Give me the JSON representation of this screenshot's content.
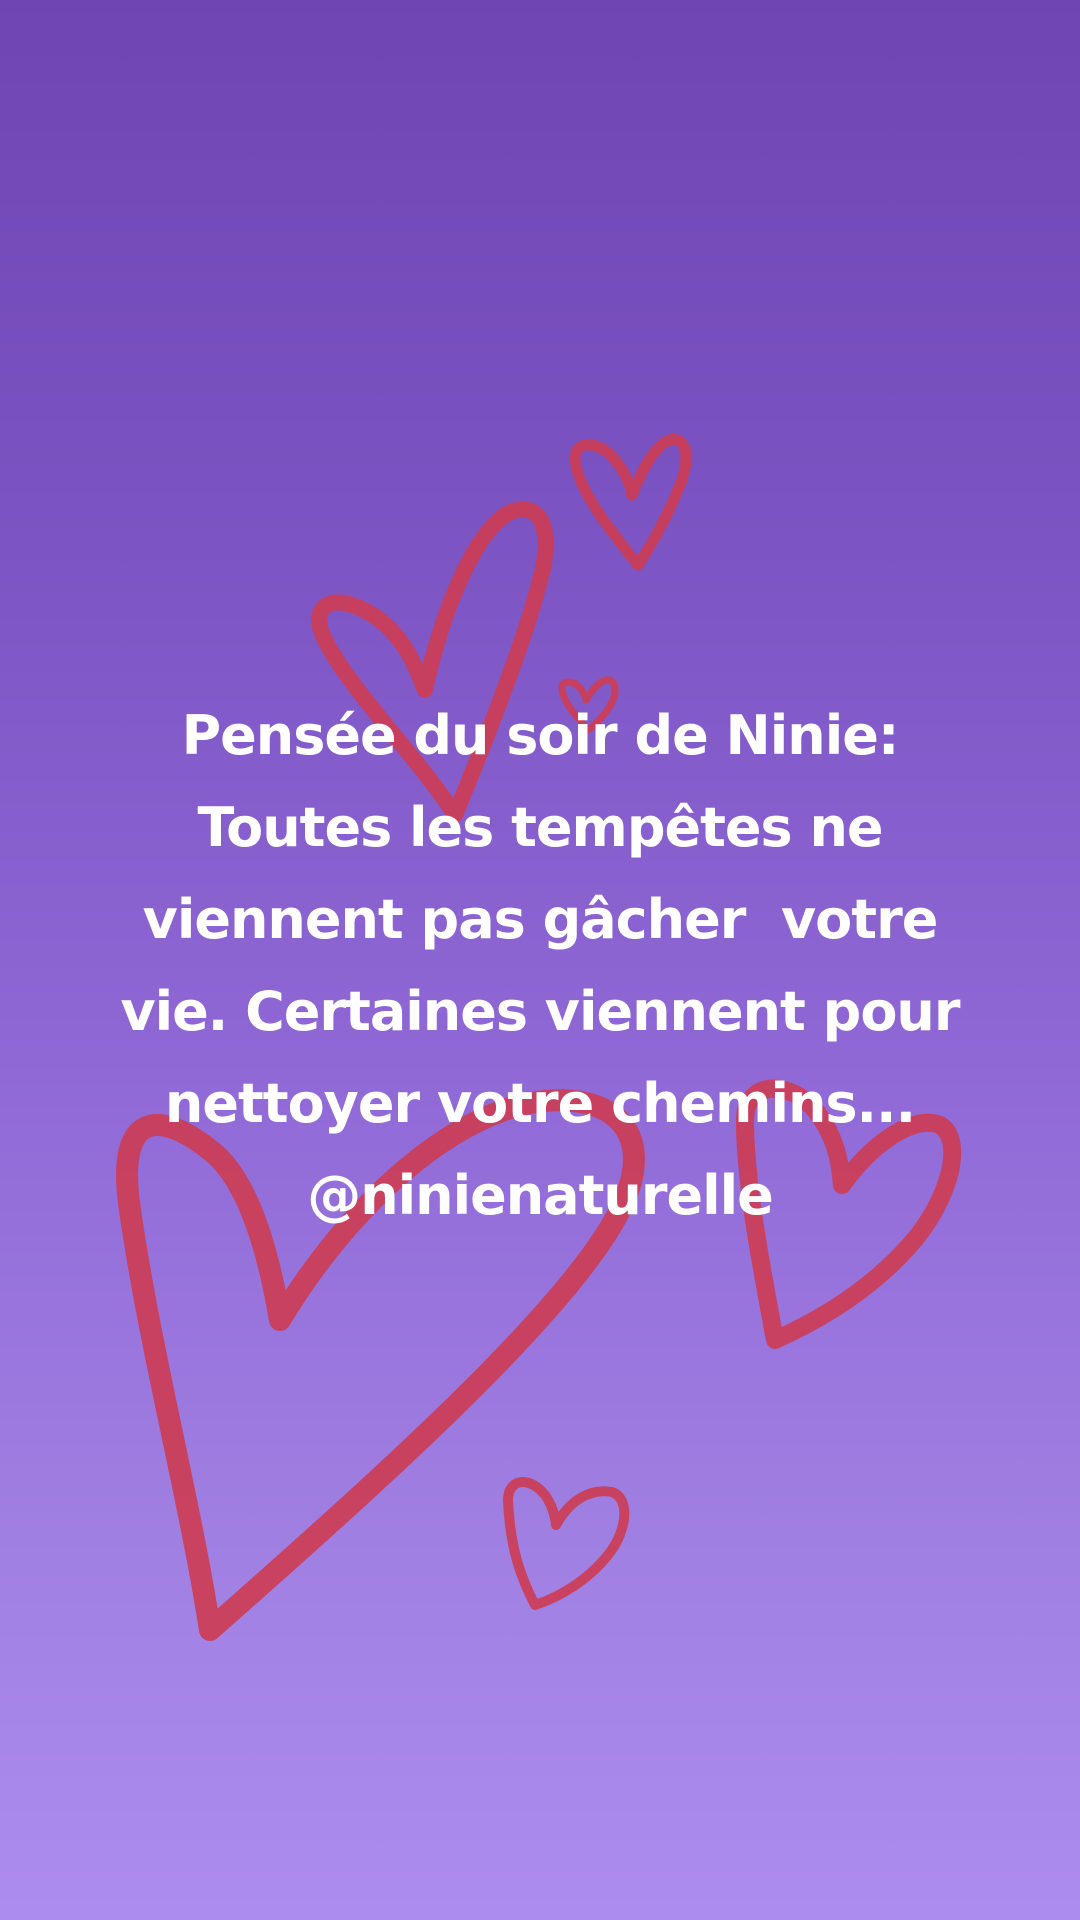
{
  "story": {
    "background_colors": [
      "#6f45b3",
      "#ad8cef"
    ],
    "heart_color": "#cc3d55",
    "caption_lines": [
      "Pensée du soir de Ninie:",
      "Toutes les tempêtes ne",
      "viennent pas gâcher  votre",
      "vie. Certaines viennent pour",
      "nettoyer votre chemins...",
      "@ninienaturelle"
    ]
  }
}
